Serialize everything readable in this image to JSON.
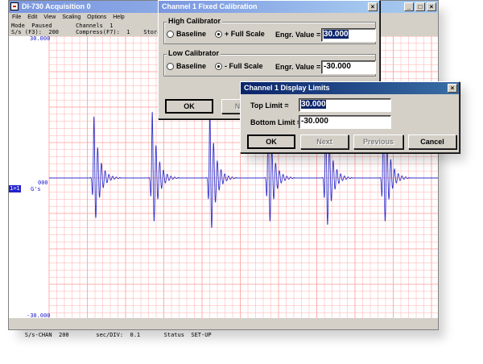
{
  "main_window": {
    "title": "DI-730 Acquisition 0",
    "menu": [
      "File",
      "Edit",
      "View",
      "Scaling",
      "Options",
      "Help"
    ],
    "status_line1": "Mode  Paused       Channels  1",
    "status_line2": "S/s (F3):  200     Compress(F7):  1    Stora",
    "y_top": "30.000",
    "y_mid": "000",
    "y_bottom": "-30.000",
    "channel_tag": "1=1",
    "unit": "G's",
    "bottom_status": "S/s-CHAN  200        sec/DIV:  0.1       Status  SET-UP",
    "colors": {
      "trace": "#3333cc",
      "grid": "#ff9999",
      "label": "#1a1ad0",
      "tag_bg": "#2222cc"
    }
  },
  "calibration_dialog": {
    "title": "Channel 1 Fixed Calibration",
    "high_title": "High Calibrator",
    "high_option1": "Baseline",
    "high_option2": "+ Full Scale",
    "high_selected": "+ Full Scale",
    "engr_label": "Engr. Value =",
    "high_value": "30.000",
    "low_title": "Low Calibrator",
    "low_option1": "Baseline",
    "low_option2": "- Full Scale",
    "low_selected": "- Full Scale",
    "low_value": "-30.000",
    "ok": "OK",
    "next_partial": "N"
  },
  "limits_dialog": {
    "title": "Channel 1 Display Limits",
    "top_label": "Top Limit =",
    "top_value": "30.000",
    "bottom_label": "Bottom Limit =",
    "bottom_value": "-30.000",
    "ok": "OK",
    "next": "Next",
    "previous": "Previous",
    "cancel": "Cancel"
  },
  "chart_data": {
    "type": "line",
    "ylim": [
      -30,
      30
    ],
    "pulse_centers_sec": [
      0.6,
      1.38,
      2.15,
      2.93,
      3.7,
      4.47
    ],
    "pulse_peaks": [
      13,
      14,
      15,
      13,
      15,
      16
    ],
    "pulse_troughs": [
      -12,
      -13,
      -15,
      -13,
      -14,
      -13
    ],
    "xlim_sec": [
      0,
      5.2
    ]
  }
}
